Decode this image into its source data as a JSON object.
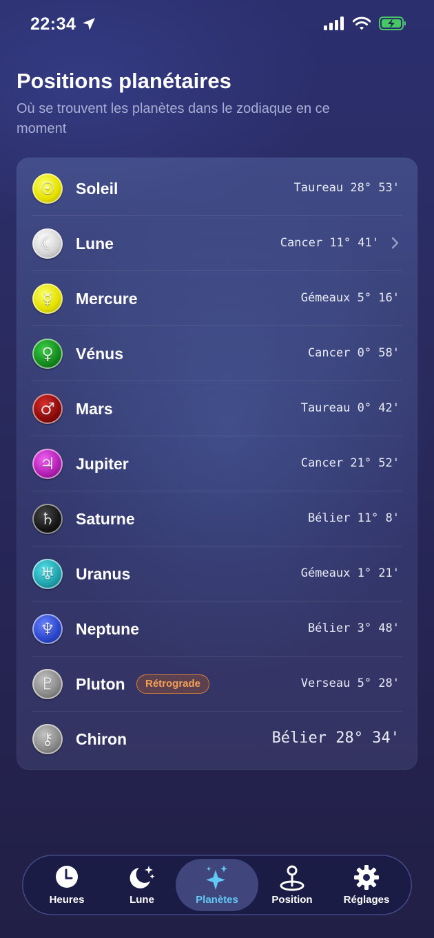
{
  "status_bar": {
    "time": "22:34"
  },
  "header": {
    "title": "Positions planétaires",
    "subtitle": "Où se trouvent les planètes dans le zodiaque en ce moment"
  },
  "planets": [
    {
      "name": "Soleil",
      "position": "Taureau 28° 53'",
      "icon": "sun-icon",
      "color": "#e6e100"
    },
    {
      "name": "Lune",
      "position": "Cancer 11° 41'",
      "icon": "moon-icon",
      "color": "#d9d9d9",
      "has_chevron": true
    },
    {
      "name": "Mercure",
      "position": "Gémeaux 5° 16'",
      "icon": "mercury-icon",
      "color": "#e3e000"
    },
    {
      "name": "Vénus",
      "position": "Cancer 0° 58'",
      "icon": "venus-icon",
      "color": "#138a1d"
    },
    {
      "name": "Mars",
      "position": "Taureau 0° 42'",
      "icon": "mars-icon",
      "color": "#8b0a0a"
    },
    {
      "name": "Jupiter",
      "position": "Cancer 21° 52'",
      "icon": "jupiter-icon",
      "color": "#b21fb4"
    },
    {
      "name": "Saturne",
      "position": "Bélier 11° 8'",
      "icon": "saturn-icon",
      "color": "#161616"
    },
    {
      "name": "Uranus",
      "position": "Gémeaux 1° 21'",
      "icon": "uranus-icon",
      "color": "#1fa2ad"
    },
    {
      "name": "Neptune",
      "position": "Bélier 3° 48'",
      "icon": "neptune-icon",
      "color": "#2b46c9"
    },
    {
      "name": "Pluton",
      "position": "Verseau 5° 28'",
      "icon": "pluto-icon",
      "color": "#8a8a8a",
      "badge": "Rétrograde"
    },
    {
      "name": "Chiron",
      "position": "Bélier 28° 34'",
      "icon": "chiron-icon",
      "color": "#8a8a8a"
    }
  ],
  "tabs": [
    {
      "label": "Heures",
      "icon": "clock-icon"
    },
    {
      "label": "Lune",
      "icon": "moon-stars-icon"
    },
    {
      "label": "Planètes",
      "icon": "sparkles-icon",
      "active": true
    },
    {
      "label": "Position",
      "icon": "location-pin-icon"
    },
    {
      "label": "Réglages",
      "icon": "gear-icon"
    }
  ],
  "colors": {
    "accent": "#62c8f5",
    "badge": "#f3a057"
  }
}
